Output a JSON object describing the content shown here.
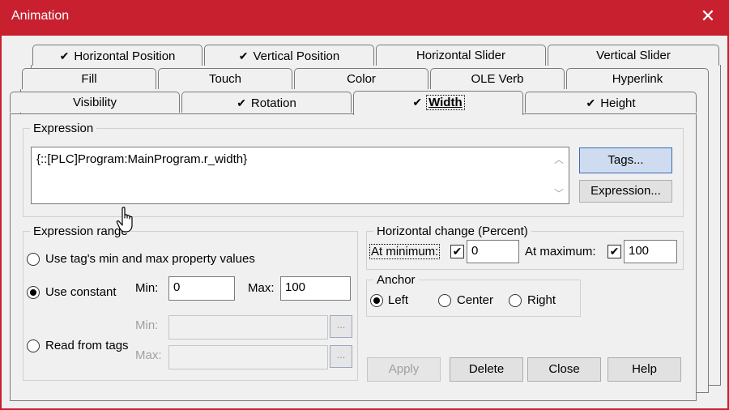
{
  "window": {
    "title": "Animation"
  },
  "tabs": {
    "row1": [
      {
        "label": "Horizontal Position",
        "checked": true
      },
      {
        "label": "Vertical Position",
        "checked": true
      },
      {
        "label": "Horizontal Slider",
        "checked": false
      },
      {
        "label": "Vertical Slider",
        "checked": false
      }
    ],
    "row2": [
      {
        "label": "Fill"
      },
      {
        "label": "Touch"
      },
      {
        "label": "Color"
      },
      {
        "label": "OLE Verb"
      },
      {
        "label": "Hyperlink"
      }
    ],
    "row3": [
      {
        "label": "Visibility",
        "checked": false
      },
      {
        "label": "Rotation",
        "checked": true
      },
      {
        "label": "Width",
        "checked": true,
        "active": true
      },
      {
        "label": "Height",
        "checked": true
      }
    ]
  },
  "expression": {
    "legend": "Expression",
    "value": "{::[PLC]Program:MainProgram.r_width}",
    "tags_button": "Tags...",
    "expression_button": "Expression..."
  },
  "range": {
    "legend": "Expression range",
    "option_tag": "Use tag's min and max property values",
    "option_constant": "Use constant",
    "option_read": "Read from tags",
    "min_label": "Min:",
    "max_label": "Max:",
    "min_value": "0",
    "max_value": "100",
    "read_min_label": "Min:",
    "read_max_label": "Max:",
    "selected": "constant"
  },
  "horizontal_change": {
    "legend": "Horizontal change (Percent)",
    "at_min_label": "At minimum:",
    "at_min_value": "0",
    "at_max_label": "At maximum:",
    "at_max_value": "100"
  },
  "anchor": {
    "legend": "Anchor",
    "left": "Left",
    "center": "Center",
    "right": "Right",
    "selected": "left"
  },
  "buttons": {
    "apply": "Apply",
    "delete": "Delete",
    "close": "Close",
    "help": "Help"
  },
  "glyphs": {
    "check": "✔",
    "close": "✕",
    "ellipsis": "...",
    "scroll_up": "︿",
    "scroll_down": "﹀"
  }
}
